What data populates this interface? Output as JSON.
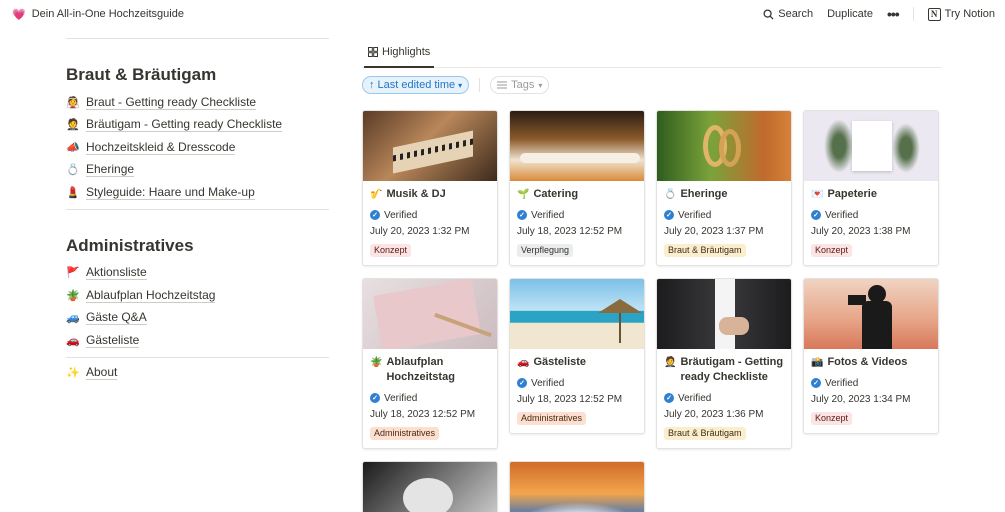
{
  "topbar": {
    "emoji": "💗",
    "title": "Dein All-in-One Hochzeitsguide",
    "search_label": "Search",
    "duplicate_label": "Duplicate",
    "more_label": "•••",
    "notion_logo": "N",
    "try_label": "Try Notion"
  },
  "sections": [
    {
      "title": "Braut & Bräutigam",
      "links": [
        {
          "emoji": "👰",
          "label": "Braut - Getting ready Checkliste"
        },
        {
          "emoji": "🤵",
          "label": "Bräutigam - Getting ready Checkliste"
        },
        {
          "emoji": "📣",
          "label": "Hochzeitskleid & Dresscode"
        },
        {
          "emoji": "💍",
          "label": "Eheringe"
        },
        {
          "emoji": "💄",
          "label": "Styleguide: Haare und Make-up"
        }
      ]
    },
    {
      "title": "Administratives",
      "links": [
        {
          "emoji": "🚩",
          "label": "Aktionsliste"
        },
        {
          "emoji": "🪴",
          "label": "Ablaufplan Hochzeitstag"
        },
        {
          "emoji": "🚙",
          "label": "Gäste Q&A"
        },
        {
          "emoji": "🚗",
          "label": "Gästeliste"
        }
      ]
    }
  ],
  "about": {
    "emoji": "✨",
    "label": "About"
  },
  "view": {
    "tab_label": "Highlights",
    "sort_label": "Last edited time",
    "tags_label": "Tags"
  },
  "verified_label": "Verified",
  "cards": [
    {
      "emoji": "🎷",
      "title": "Musik & DJ",
      "date": "July 20, 2023 1:32 PM",
      "tag": "Konzept",
      "tag_color": "red",
      "cover": "music"
    },
    {
      "emoji": "🌱",
      "title": "Catering",
      "date": "July 18, 2023 12:52 PM",
      "tag": "Verpflegung",
      "tag_color": "gray",
      "cover": "catering"
    },
    {
      "emoji": "💍",
      "title": "Eheringe",
      "date": "July 20, 2023 1:37 PM",
      "tag": "Braut & Bräutigam",
      "tag_color": "yellow",
      "cover": "rings"
    },
    {
      "emoji": "💌",
      "title": "Papeterie",
      "date": "July 20, 2023 1:38 PM",
      "tag": "Konzept",
      "tag_color": "red",
      "cover": "paper"
    },
    {
      "emoji": "🪴",
      "title": "Ablaufplan Hochzeitstag",
      "date": "July 18, 2023 12:52 PM",
      "tag": "Administratives",
      "tag_color": "orange",
      "cover": "planner"
    },
    {
      "emoji": "🚗",
      "title": "Gästeliste",
      "date": "July 18, 2023 12:52 PM",
      "tag": "Administratives",
      "tag_color": "orange",
      "cover": "beach"
    },
    {
      "emoji": "🤵",
      "title": "Bräutigam - Getting ready Checkliste",
      "date": "July 20, 2023 1:36 PM",
      "tag": "Braut & Bräutigam",
      "tag_color": "yellow",
      "cover": "suit"
    },
    {
      "emoji": "📸",
      "title": "Fotos & Videos",
      "date": "July 20, 2023 1:34 PM",
      "tag": "Konzept",
      "tag_color": "red",
      "cover": "photo"
    },
    {
      "cover": "couple"
    },
    {
      "cover": "sky"
    }
  ]
}
